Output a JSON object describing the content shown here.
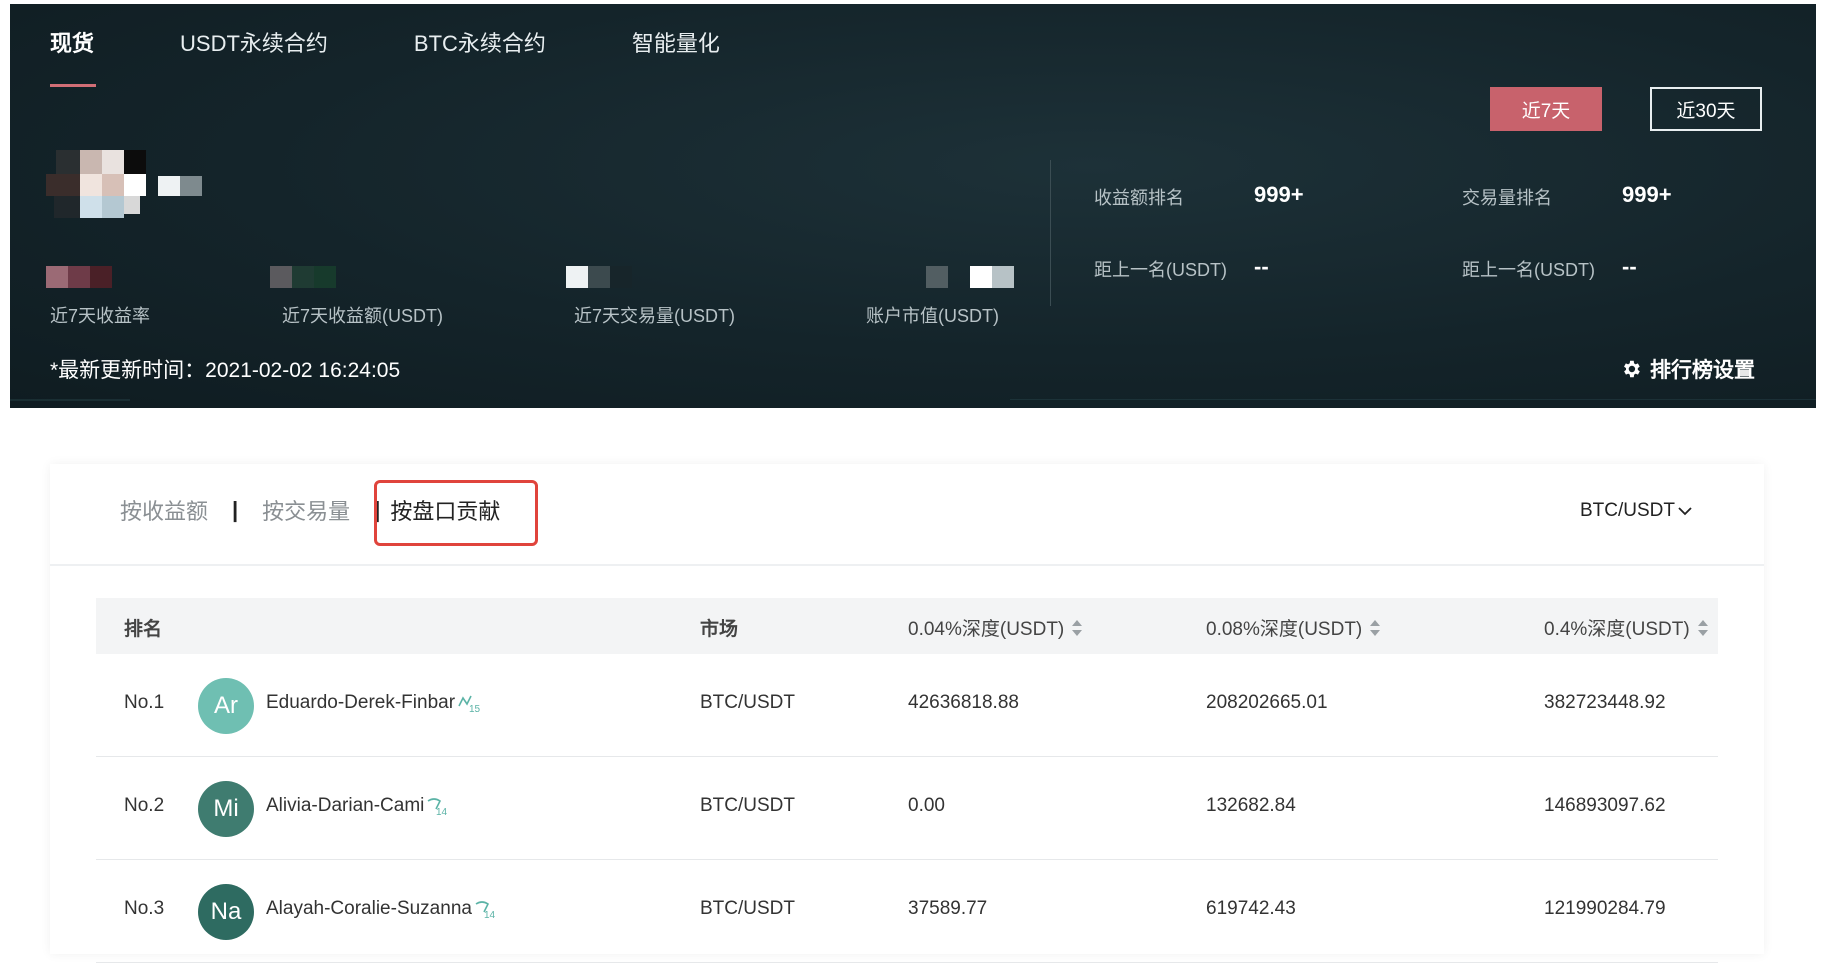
{
  "top_tabs": [
    "现货",
    "USDT永续合约",
    "BTC永续合约",
    "智能量化"
  ],
  "period_buttons": {
    "active": "近7天",
    "other": "近30天"
  },
  "stats": {
    "labels": [
      "近7天收益率",
      "近7天收益额(USDT)",
      "近7天交易量(USDT)",
      "账户市值(USDT)"
    ]
  },
  "ranking": {
    "profit_rank_label": "收益额排名",
    "profit_rank_value": "999+",
    "volume_rank_label": "交易量排名",
    "volume_rank_value": "999+",
    "gap_label_1": "距上一名(USDT)",
    "gap_value_1": "--",
    "gap_label_2": "距上一名(USDT)",
    "gap_value_2": "--"
  },
  "update_time": "*最新更新时间：2021-02-02 16:24:05",
  "settings_label": "排行榜设置",
  "sort_tabs": [
    "按收益额",
    "按交易量",
    "按盘口贡献"
  ],
  "market_select": "BTC/USDT",
  "table": {
    "headers": [
      "排名",
      "市场",
      "0.04%深度(USDT)",
      "0.08%深度(USDT)",
      "0.4%深度(USDT)"
    ],
    "rows": [
      {
        "rank": "No.1",
        "avatar": "Ar",
        "avatar_color": "#6fbfb2",
        "name": "Eduardo-Derek-Finbar",
        "level": "15",
        "market": "BTC/USDT",
        "d004": "42636818.88",
        "d008": "208202665.01",
        "d04": "382723448.92"
      },
      {
        "rank": "No.2",
        "avatar": "Mi",
        "avatar_color": "#3f7c70",
        "name": "Alivia-Darian-Cami",
        "level": "14",
        "market": "BTC/USDT",
        "d004": "0.00",
        "d008": "132682.84",
        "d04": "146893097.62"
      },
      {
        "rank": "No.3",
        "avatar": "Na",
        "avatar_color": "#2e6b61",
        "name": "Alayah-Coralie-Suzanna",
        "level": "14",
        "market": "BTC/USDT",
        "d004": "37589.77",
        "d008": "619742.43",
        "d04": "121990284.79"
      }
    ]
  },
  "colors": {
    "accent": "#c8626c",
    "banner_bg": "#14242a",
    "highlight_box": "#e0443c"
  }
}
